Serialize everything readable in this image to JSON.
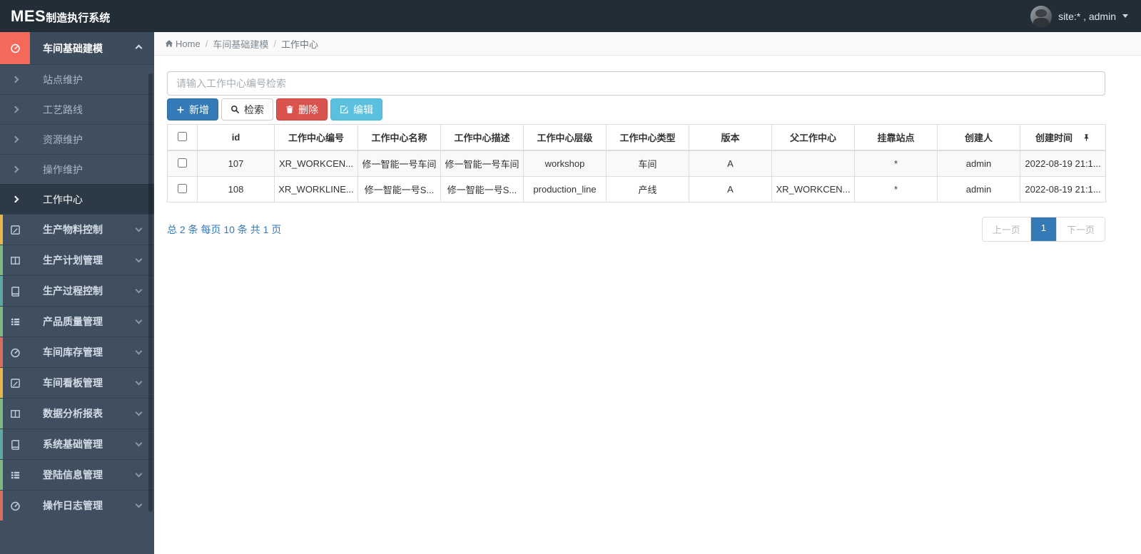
{
  "navbar": {
    "logo_primary": "MES",
    "logo_secondary": "制造执行系统",
    "user_label": "site:* , admin"
  },
  "breadcrumb": {
    "home": "Home",
    "separator": "/",
    "items": [
      "车间基础建模",
      "工作中心"
    ]
  },
  "sidebar": {
    "active_group": {
      "label": "车间基础建模",
      "accent_color": "#f4695c",
      "items": [
        {
          "label": "站点维护",
          "active": false
        },
        {
          "label": "工艺路线",
          "active": false
        },
        {
          "label": "资源维护",
          "active": false
        },
        {
          "label": "操作维护",
          "active": false
        },
        {
          "label": "工作中心",
          "active": true
        }
      ]
    },
    "groups": [
      {
        "label": "生产物料控制",
        "icon": "pencil-square-icon",
        "stripe_color": "#e7b54a"
      },
      {
        "label": "生产计划管理",
        "icon": "columns-icon",
        "stripe_color": "#81b77e"
      },
      {
        "label": "生产过程控制",
        "icon": "book-icon",
        "stripe_color": "#5fa8a0"
      },
      {
        "label": "产品质量管理",
        "icon": "list-icon",
        "stripe_color": "#81b77e"
      },
      {
        "label": "车间库存管理",
        "icon": "gauge-icon",
        "stripe_color": "#d96c5f"
      },
      {
        "label": "车间看板管理",
        "icon": "pencil-square-icon",
        "stripe_color": "#e7b54a"
      },
      {
        "label": "数据分析报表",
        "icon": "columns-icon",
        "stripe_color": "#81b77e"
      },
      {
        "label": "系统基础管理",
        "icon": "book-icon",
        "stripe_color": "#5fa8a0"
      },
      {
        "label": "登陆信息管理",
        "icon": "list-icon",
        "stripe_color": "#81b77e"
      },
      {
        "label": "操作日志管理",
        "icon": "gauge-icon",
        "stripe_color": "#d96c5f"
      }
    ]
  },
  "toolbar": {
    "search_placeholder": "请输入工作中心编号检索",
    "buttons": [
      {
        "label": "新增",
        "icon": "plus-icon",
        "style": "primary",
        "color": "#337ab7"
      },
      {
        "label": "检索",
        "icon": "search-icon",
        "style": "default",
        "color": "#ffffff"
      },
      {
        "label": "删除",
        "icon": "trash-icon",
        "style": "danger",
        "color": "#d9534f"
      },
      {
        "label": "编辑",
        "icon": "edit-icon",
        "style": "info",
        "color": "#5bc0de"
      }
    ]
  },
  "table": {
    "columns": [
      "id",
      "工作中心编号",
      "工作中心名称",
      "工作中心描述",
      "工作中心层级",
      "工作中心类型",
      "版本",
      "父工作中心",
      "挂靠站点",
      "创建人",
      "创建时间"
    ],
    "rows": [
      [
        "107",
        "XR_WORKCEN...",
        "修一智能一号车间",
        "修一智能一号车间",
        "workshop",
        "车间",
        "A",
        "",
        "*",
        "admin",
        "2022-08-19 21:1..."
      ],
      [
        "108",
        "XR_WORKLINE...",
        "修一智能一号S...",
        "修一智能一号S...",
        "production_line",
        "产线",
        "A",
        "XR_WORKCEN...",
        "*",
        "admin",
        "2022-08-19 21:1..."
      ]
    ]
  },
  "pagination": {
    "summary": "总 2 条 每页 10 条 共 1 页",
    "prev_label": "上一页",
    "current_page": "1",
    "next_label": "下一页"
  }
}
